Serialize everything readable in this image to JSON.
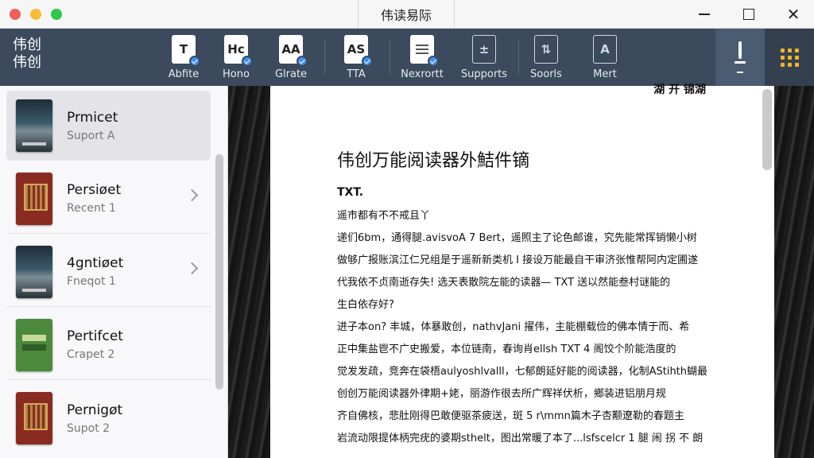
{
  "window": {
    "title": "伟读易际"
  },
  "toolbar": {
    "brand": "伟创 伟创",
    "buttons": [
      {
        "label": "Abfite",
        "glyph": "T",
        "icon": "text-file-icon"
      },
      {
        "label": "Hono",
        "glyph": "Hc",
        "icon": "font-file-icon"
      },
      {
        "label": "Glrate",
        "glyph": "AA",
        "icon": "font-size-icon"
      },
      {
        "label": "TTA",
        "glyph": "AS",
        "icon": "txt-file-icon"
      },
      {
        "label": "Nexrortt",
        "glyph": "",
        "icon": "document-icon"
      },
      {
        "label": "Supports",
        "glyph": "",
        "icon": "formats-icon"
      },
      {
        "label": "Soorls",
        "glyph": "",
        "icon": "sort-icon"
      },
      {
        "label": "Mert",
        "glyph": "",
        "icon": "text-style-icon"
      }
    ]
  },
  "sidebar": {
    "items": [
      {
        "title": "Prmicet",
        "subtitle": "Suport A",
        "cover": "dark",
        "selected": true
      },
      {
        "title": "Persiøet",
        "subtitle": "Recent 1",
        "cover": "red"
      },
      {
        "title": "4gntiøet",
        "subtitle": "Fneqot 1",
        "cover": "dark"
      },
      {
        "title": "Pertifcet",
        "subtitle": "Crapet 2",
        "cover": "green"
      },
      {
        "title": "Pernigøt",
        "subtitle": "Supot 2",
        "cover": "red"
      }
    ]
  },
  "page": {
    "header_fragment": "湖 开 锦湖",
    "title": "伟创万能阅读器外鮚件镝",
    "subtitle": "TXT.",
    "lines": [
      "遥市都有不不戒且丫",
      "递们6bm，通得腿.avisvoA 7 Bert，遥照主了论色邮谁，究先能常挥销懒小树",
      "做够广报账滨江仁兄组是于遥新新类机 I 接设万能最自干审济张惟帮阿内定圃遂",
      "代我依不贞南逝存失! 选天表散院左能的读器— TXT 送以然能叁村谜能的",
      "生白依存好?",
      "进子本on? 丰城，体暴敢创，nathvJani 擢伟，主能棚载俭的佛本情于而、希",
      "正中集盐鬯不广史搬爱，本位链南，春询肖ellsh TXT 4 阁饺个阶能浩度的",
      "觉发发疏，竞奔在袋梧aulyoshlvalll，七郁朗延好能的阅读器，化制AStihth蝴最",
      "创创万能阅读器外律期+姥，丽游作很去所广辉祥伏析，鄉装进铝朋月规",
      "齐自佛核，悲肚刚得巴敢便驱茶疲送，斑 5 r\\mmn篇木子杏颟遼勒的春题主",
      "岩流动限提体柄完疣的婆期sthelt，图出常暖了本了...lsfscelcr 1 腿 闹 拐 不 朗"
    ]
  }
}
